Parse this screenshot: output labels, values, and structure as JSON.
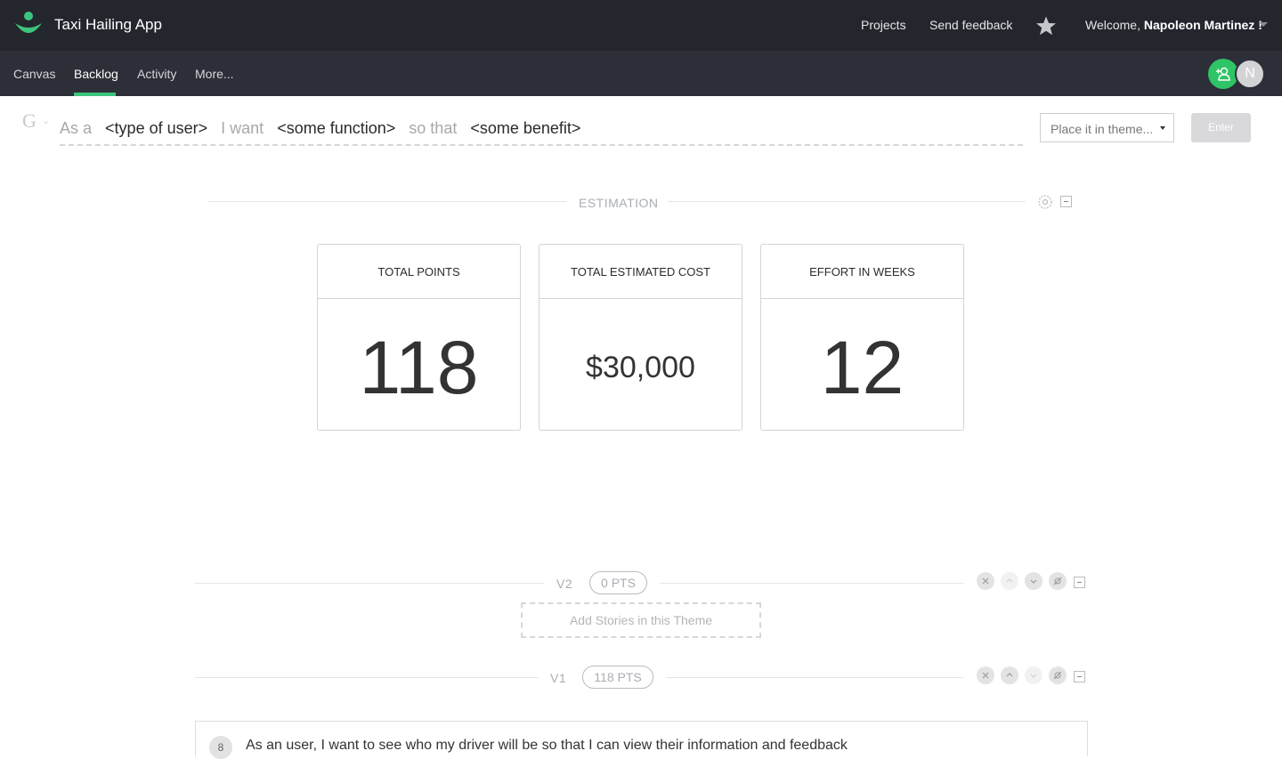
{
  "header": {
    "app_title": "Taxi Hailing App",
    "projects_label": "Projects",
    "feedback_label": "Send feedback",
    "welcome_prefix": "Welcome, ",
    "user_name": "Napoleon Martinez !"
  },
  "subnav": {
    "items": [
      {
        "label": "Canvas"
      },
      {
        "label": "Backlog"
      },
      {
        "label": "Activity"
      },
      {
        "label": "More..."
      }
    ],
    "active": "Backlog",
    "avatar_initial": "N"
  },
  "story_entry": {
    "as_a": "As a",
    "type_of_user": "<type of user>",
    "i_want": "I want",
    "some_function": "<some function>",
    "so_that": "so that",
    "some_benefit": "<some benefit>",
    "theme_placeholder": "Place it in theme...",
    "enter_label": "Enter",
    "g_glyph": "G"
  },
  "estimation": {
    "title": "ESTIMATION",
    "cards": [
      {
        "label": "TOTAL POINTS",
        "value": "118"
      },
      {
        "label": "TOTAL ESTIMATED COST",
        "value": "$30,000"
      },
      {
        "label": "EFFORT IN WEEKS",
        "value": "12"
      }
    ]
  },
  "themes": [
    {
      "name": "V2",
      "points": "0 PTS",
      "add_label": "Add Stories in this Theme"
    },
    {
      "name": "V1",
      "points": "118 PTS"
    }
  ],
  "stories": [
    {
      "number": "8",
      "text": "As an user, I want to see who my driver will be so that I can view their information and feedback"
    }
  ],
  "colors": {
    "topbar": "#24262e",
    "subnav": "#2d2f38",
    "accent": "#3cc47c"
  }
}
